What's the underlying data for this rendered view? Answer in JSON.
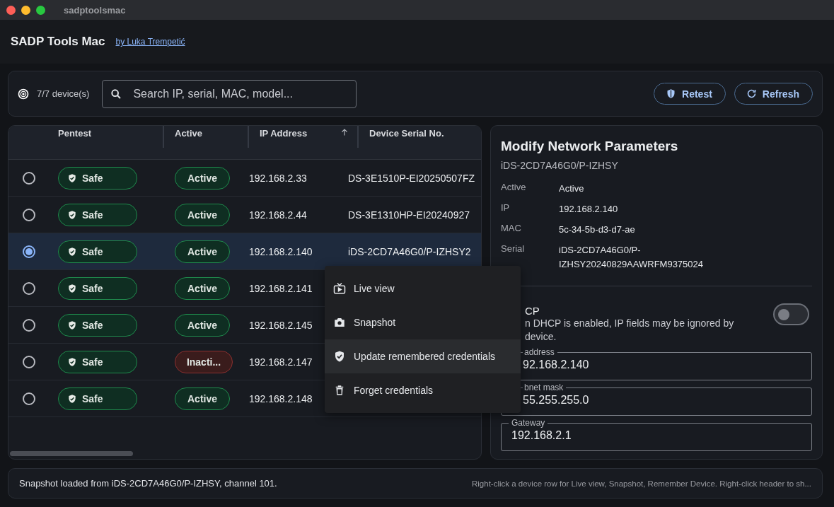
{
  "window": {
    "title": "sadptoolsmac"
  },
  "header": {
    "title": "SADP Tools Mac",
    "author_link": "by Luka Trempetić"
  },
  "toolbar": {
    "device_count": "7/7 device(s)",
    "search": {
      "placeholder": "Search IP, serial, MAC, model..."
    },
    "buttons": [
      {
        "kind": "retest",
        "label": "Retest"
      },
      {
        "kind": "refresh",
        "label": "Refresh"
      }
    ]
  },
  "table": {
    "columns": [
      {
        "label": "Pentest",
        "sorted": false
      },
      {
        "label": "Active",
        "sorted": false
      },
      {
        "label": "IP Address",
        "sorted": true
      },
      {
        "label": "Device Serial No.",
        "sorted": false
      }
    ],
    "rows": [
      {
        "selected": false,
        "pentest": "Safe",
        "active": {
          "label": "Active",
          "kind": "active"
        },
        "ip": "192.168.2.33",
        "serial": "DS-3E1510P-EI20250507FZ"
      },
      {
        "selected": false,
        "pentest": "Safe",
        "active": {
          "label": "Active",
          "kind": "active"
        },
        "ip": "192.168.2.44",
        "serial": "DS-3E1310HP-EI20240927"
      },
      {
        "selected": true,
        "pentest": "Safe",
        "active": {
          "label": "Active",
          "kind": "active"
        },
        "ip": "192.168.2.140",
        "serial": "iDS-2CD7A46G0/P-IZHSY2"
      },
      {
        "selected": false,
        "pentest": "Safe",
        "active": {
          "label": "Active",
          "kind": "active"
        },
        "ip": "192.168.2.141"
      },
      {
        "selected": false,
        "pentest": "Safe",
        "active": {
          "label": "Active",
          "kind": "active"
        },
        "ip": "192.168.2.145"
      },
      {
        "selected": false,
        "pentest": "Safe",
        "active": {
          "label": "Inacti...",
          "kind": "inactive"
        },
        "ip": "192.168.2.147"
      },
      {
        "selected": false,
        "pentest": "Safe",
        "active": {
          "label": "Active",
          "kind": "active"
        },
        "ip": "192.168.2.148"
      }
    ]
  },
  "context_menu": {
    "items": [
      {
        "kind": "live",
        "label": "Live view",
        "selected": false
      },
      {
        "kind": "snapshot",
        "label": "Snapshot",
        "selected": false
      },
      {
        "kind": "credentials",
        "label": "Update remembered credentials",
        "selected": true
      },
      {
        "kind": "forget",
        "label": "Forget credentials",
        "selected": false
      }
    ]
  },
  "panel": {
    "title": "Modify Network Parameters",
    "subtitle": "iDS-2CD7A46G0/P-IZHSY",
    "details": [
      {
        "label": "Active",
        "value": "Active"
      },
      {
        "label": "IP",
        "value": "192.168.2.140"
      },
      {
        "label": "MAC",
        "value": "5c-34-5b-d3-d7-ae"
      },
      {
        "label": "Serial",
        "value": "iDS-2CD7A46G0/P-IZHSY20240829AAWRFM9375024"
      }
    ],
    "dhcp": {
      "title": "CP",
      "description": "n DHCP is enabled, IP fields may be ignored by",
      "description_2": "device.",
      "on": false
    },
    "fields": [
      {
        "label": "address",
        "value": "92.168.2.140"
      },
      {
        "label": "bnet mask",
        "value": "55.255.255.0"
      },
      {
        "label": "Gateway",
        "value": "192.168.2.1"
      }
    ]
  },
  "status_bar": {
    "message": "Snapshot loaded from iDS-2CD7A46G0/P-IZHSY, channel 101.",
    "hint": "Right-click a device row for Live view, Snapshot, Remember Device. Right-click header to sh..."
  }
}
